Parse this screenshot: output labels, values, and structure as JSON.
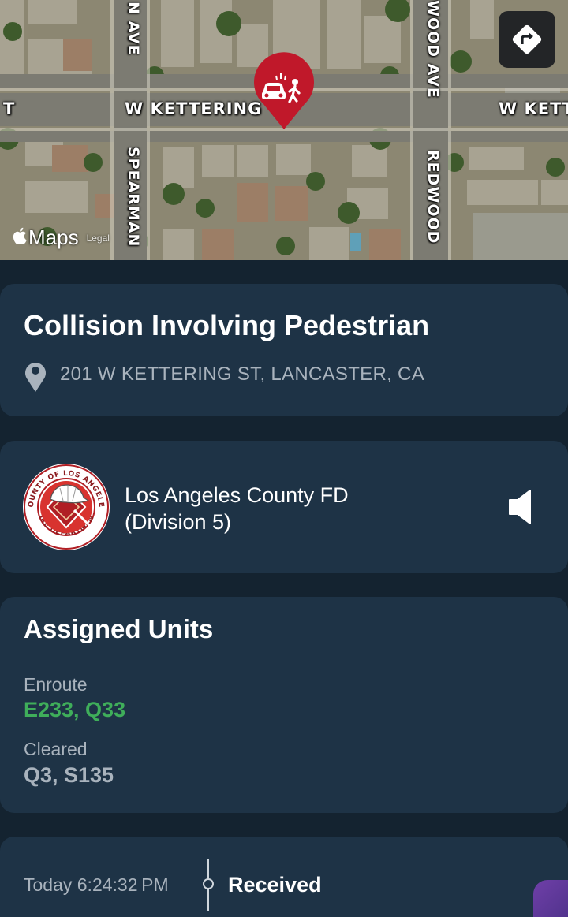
{
  "map": {
    "streets": {
      "kettering_left": "W KETTERING",
      "kettering_right": "W KETT",
      "kettering_edge": "T",
      "avenue_top_left": "N AVE",
      "spearman": "SPEARMAN",
      "redwood_top": "WOOD AVE",
      "redwood_bottom": "REDWOOD"
    },
    "attribution": "Maps",
    "legal": "Legal",
    "icons": {
      "directions": "directions-icon",
      "pin": "collision-pedestrian-pin-icon",
      "apple": "apple-logo-icon"
    }
  },
  "incident": {
    "title": "Collision Involving Pedestrian",
    "address": "201 W KETTERING ST, LANCASTER, CA",
    "icon": "location-pin-icon"
  },
  "agency": {
    "name_line1": "Los Angeles County FD",
    "name_line2": "(Division 5)",
    "logo": "county-of-los-angeles-fire-department-seal",
    "audio_icon": "speaker-icon"
  },
  "units": {
    "title": "Assigned Units",
    "enroute_label": "Enroute",
    "enroute_values": "E233, Q33",
    "cleared_label": "Cleared",
    "cleared_values": "Q3, S135"
  },
  "timeline": {
    "time": "Today 6:24:32 PM",
    "status": "Received"
  },
  "colors": {
    "background": "#142330",
    "card": "#1e3346",
    "enroute": "#3fae5a",
    "muted_text": "#a9b3bd",
    "pin": "#c0182a"
  }
}
